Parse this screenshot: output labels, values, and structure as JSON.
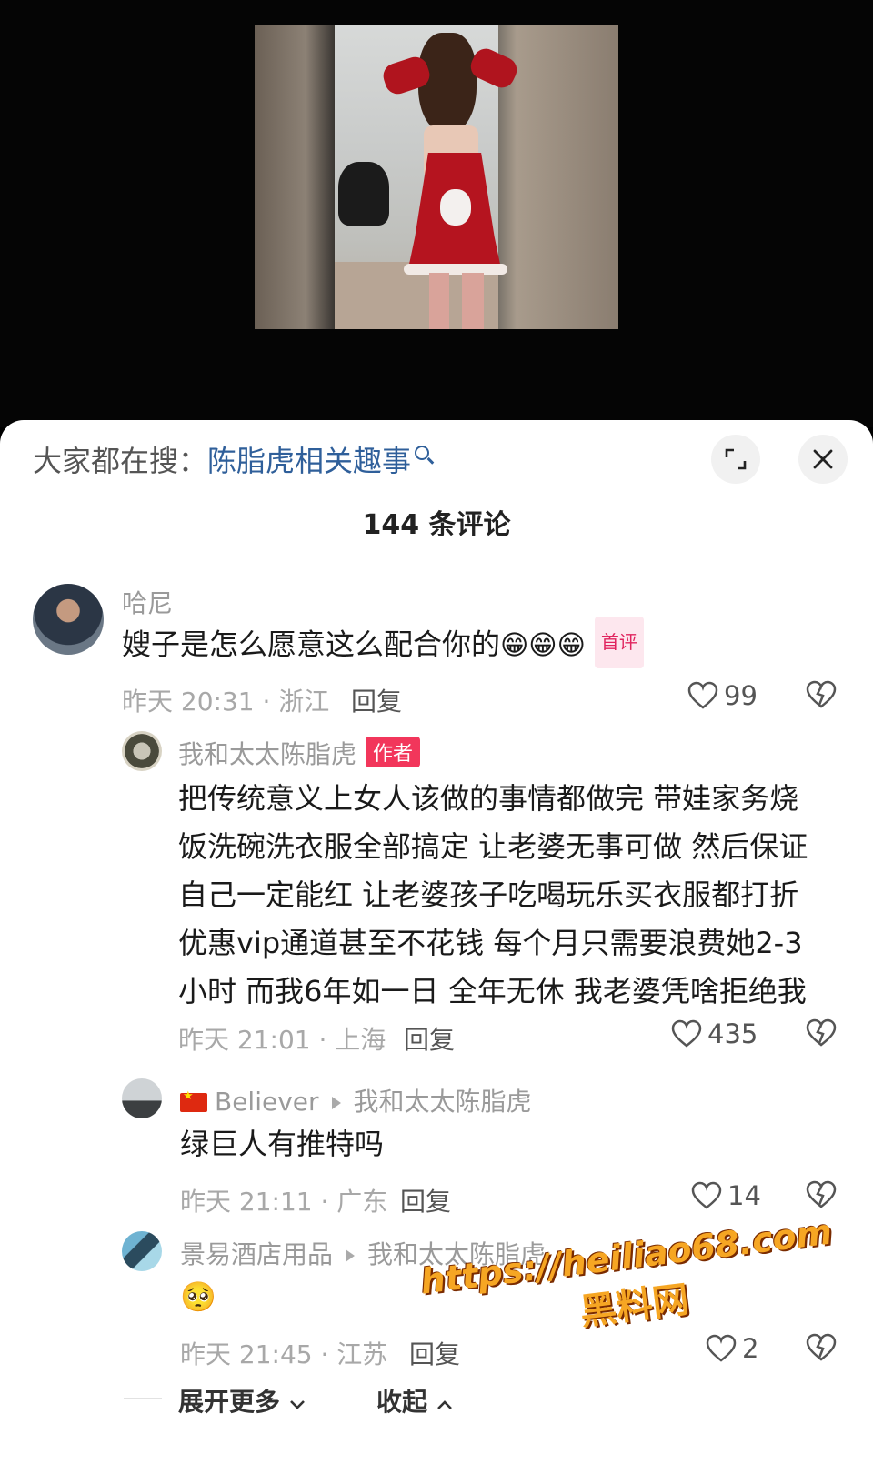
{
  "search_hint": {
    "prefix": "大家都在搜：",
    "query": "陈脂虎相关趣事"
  },
  "comment_count": "144 条评论",
  "comments": [
    {
      "user": "哈尼",
      "text": "嫂子是怎么愿意这么配合你的",
      "emoji": "😁😁😁",
      "badge": "首评",
      "time_location": "昨天 20:31 · 浙江",
      "reply": "回复",
      "likes": "99"
    }
  ],
  "replies": [
    {
      "user": "我和太太陈脂虎",
      "badge": "作者",
      "lines": [
        "把传统意义上女人该做的事情都做完 带娃家务烧",
        "饭洗碗洗衣服全部搞定 让老婆无事可做 然后保证",
        "自己一定能红 让老婆孩子吃喝玩乐买衣服都打折",
        "优惠vip通道甚至不花钱 每个月只需要浪费她2-3",
        "小时 而我6年如一日 全年无休 我老婆凭啥拒绝我"
      ],
      "time_location": "昨天 21:01 · 上海",
      "reply": "回复",
      "likes": "435"
    },
    {
      "user": "Believer",
      "reply_to": "我和太太陈脂虎",
      "text": "绿巨人有推特吗",
      "time_location": "昨天 21:11 · 广东",
      "reply": "回复",
      "likes": "14"
    },
    {
      "user": "景易酒店用品",
      "reply_to": "我和太太陈脂虎",
      "text": "🥺",
      "time_location": "昨天 21:45 · 江苏",
      "reply": "回复",
      "likes": "2"
    }
  ],
  "footer": {
    "expand_more": "展开更多",
    "collapse": "收起"
  },
  "watermark": {
    "url": "https://heiliao68.com",
    "name": "黑料网"
  },
  "colors": {
    "accent_link": "#2f5f9a",
    "badge_red": "#f2365b",
    "watermark": "#f6a623"
  }
}
